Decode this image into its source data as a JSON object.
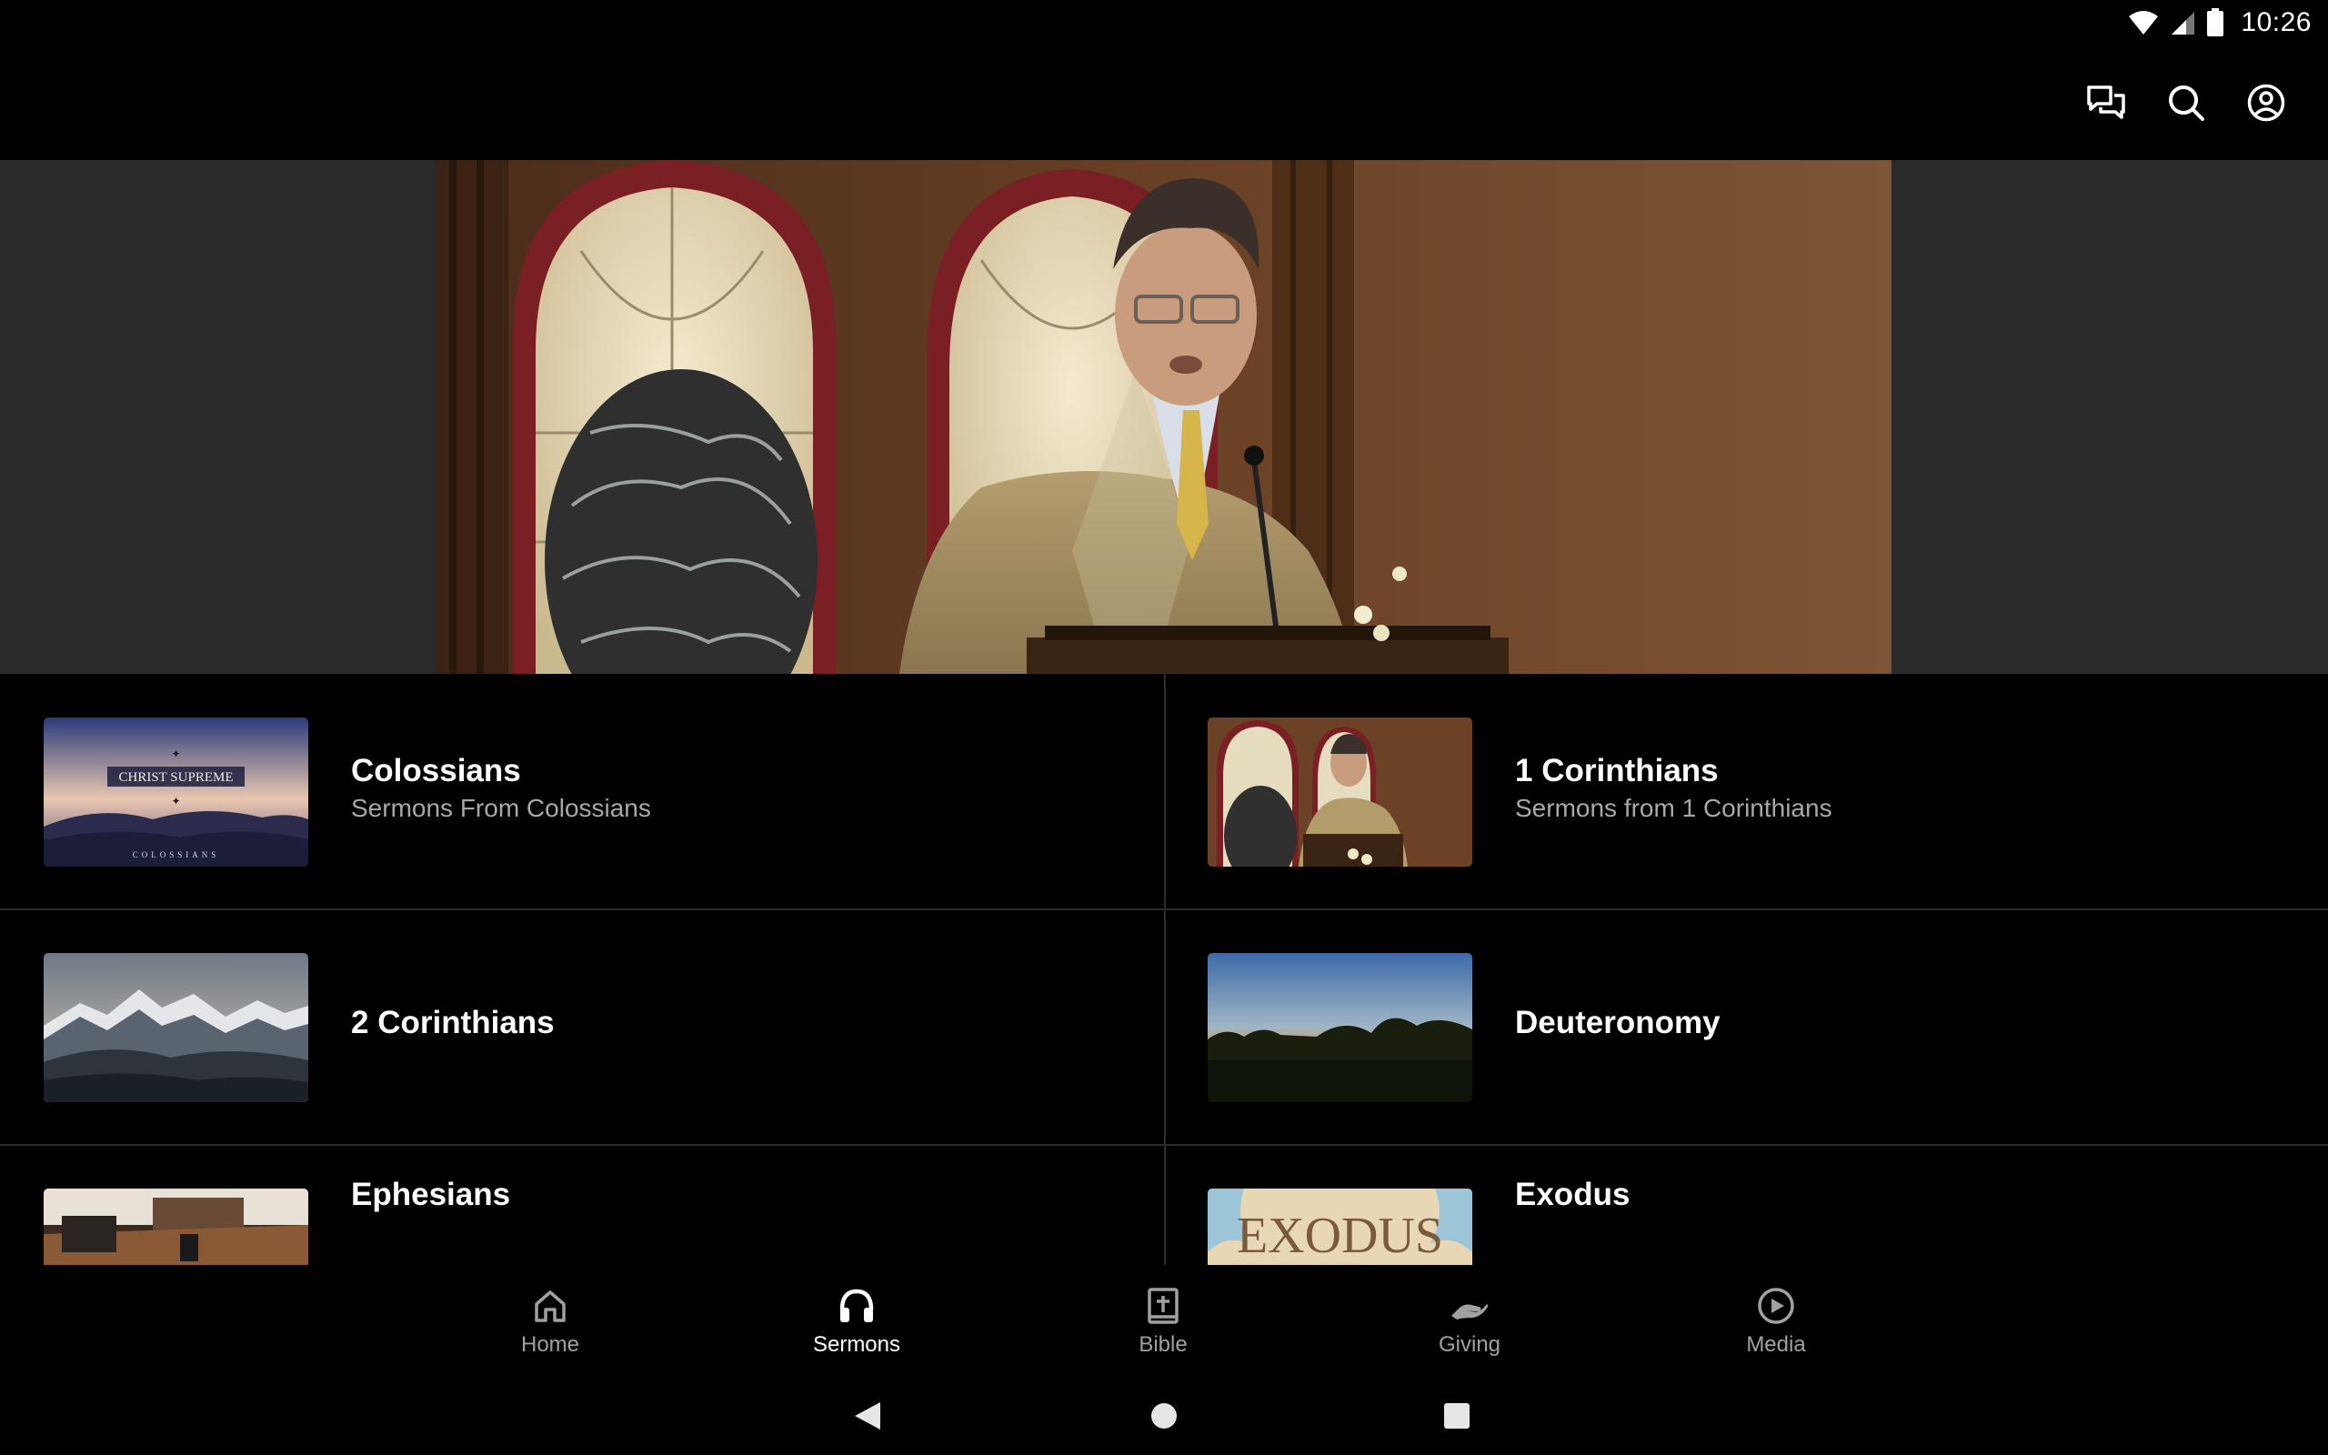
{
  "status_bar": {
    "time": "10:26",
    "icons": [
      "wifi-icon",
      "cell-signal-icon",
      "battery-icon"
    ]
  },
  "app_bar": {
    "actions": [
      {
        "name": "chat-icon"
      },
      {
        "name": "search-icon"
      },
      {
        "name": "account-icon"
      }
    ]
  },
  "hero": {
    "image": "preacher-at-pulpit"
  },
  "series": [
    {
      "title": "Colossians",
      "subtitle": "Sermons From Colossians",
      "thumb_text": "CHRIST SUPREME",
      "thumb_caption": "COLOSSIANS"
    },
    {
      "title": "1 Corinthians",
      "subtitle": "Sermons from 1 Corinthians"
    },
    {
      "title": "2 Corinthians",
      "subtitle": ""
    },
    {
      "title": "Deuteronomy",
      "subtitle": ""
    },
    {
      "title": "Ephesians",
      "subtitle": ""
    },
    {
      "title": "Exodus",
      "subtitle": "",
      "thumb_text": "EXODUS"
    }
  ],
  "bottom_nav": {
    "items": [
      {
        "label": "Home",
        "icon": "home-icon",
        "active": false
      },
      {
        "label": "Sermons",
        "icon": "headphones-icon",
        "active": true
      },
      {
        "label": "Bible",
        "icon": "bible-icon",
        "active": false
      },
      {
        "label": "Giving",
        "icon": "giving-hand-icon",
        "active": false
      },
      {
        "label": "Media",
        "icon": "play-circle-icon",
        "active": false
      }
    ]
  },
  "colors": {
    "background": "#000000",
    "hero_band": "#2a2a2a",
    "divider": "#2c2c2c",
    "subtitle": "#a8a8a8",
    "nav_inactive": "#a0a0a0",
    "nav_active": "#ffffff"
  }
}
